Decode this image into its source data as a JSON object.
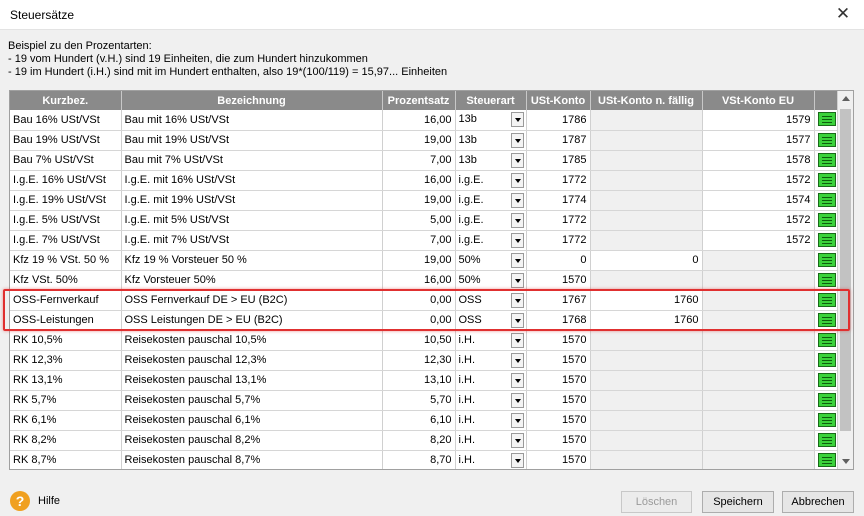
{
  "window": {
    "title": "Steuersätze"
  },
  "info": {
    "line1": "Beispiel zu den Prozentarten:",
    "line2": "- 19 vom Hundert (v.H.) sind 19 Einheiten, die zum Hundert hinzukommen",
    "line3": "- 19 im Hundert (i.H.) sind mit im Hundert enthalten, also 19*(100/119) = 15,97... Einheiten"
  },
  "table": {
    "columns": [
      "Kurzbez.",
      "Bezeichnung",
      "Prozentsatz",
      "Steuerart",
      "USt-Konto",
      "USt-Konto n. fällig",
      "VSt-Konto EU",
      ""
    ],
    "rows": [
      {
        "k": "Bau 16% USt/VSt",
        "b": "Bau mit 16% USt/VSt",
        "p": "16,00",
        "s": "13b",
        "u": "1786",
        "n": "",
        "v": "1579"
      },
      {
        "k": "Bau 19% USt/VSt",
        "b": "Bau mit 19% USt/VSt",
        "p": "19,00",
        "s": "13b",
        "u": "1787",
        "n": "",
        "v": "1577"
      },
      {
        "k": "Bau 7% USt/VSt",
        "b": "Bau mit 7% USt/VSt",
        "p": "7,00",
        "s": "13b",
        "u": "1785",
        "n": "",
        "v": "1578"
      },
      {
        "k": "I.g.E. 16% USt/VSt",
        "b": "I.g.E. mit 16% USt/VSt",
        "p": "16,00",
        "s": "i.g.E.",
        "u": "1772",
        "n": "",
        "v": "1572"
      },
      {
        "k": "I.g.E. 19% USt/VSt",
        "b": "I.g.E. mit 19% USt/VSt",
        "p": "19,00",
        "s": "i.g.E.",
        "u": "1774",
        "n": "",
        "v": "1574"
      },
      {
        "k": "I.g.E. 5% USt/VSt",
        "b": "I.g.E. mit 5% USt/VSt",
        "p": "5,00",
        "s": "i.g.E.",
        "u": "1772",
        "n": "",
        "v": "1572"
      },
      {
        "k": "I.g.E. 7% USt/VSt",
        "b": "I.g.E. mit 7% USt/VSt",
        "p": "7,00",
        "s": "i.g.E.",
        "u": "1772",
        "n": "",
        "v": "1572"
      },
      {
        "k": "Kfz 19 % VSt. 50 %",
        "b": "Kfz 19 % Vorsteuer 50 %",
        "p": "19,00",
        "s": "50%",
        "u": "0",
        "n": "0",
        "v": ""
      },
      {
        "k": "Kfz VSt. 50%",
        "b": "Kfz Vorsteuer 50%",
        "p": "16,00",
        "s": "50%",
        "u": "1570",
        "n": "",
        "v": ""
      },
      {
        "k": "OSS-Fernverkauf",
        "b": "OSS Fernverkauf DE > EU (B2C)",
        "p": "0,00",
        "s": "OSS",
        "u": "1767",
        "n": "1760",
        "v": ""
      },
      {
        "k": "OSS-Leistungen",
        "b": "OSS Leistungen DE > EU (B2C)",
        "p": "0,00",
        "s": "OSS",
        "u": "1768",
        "n": "1760",
        "v": ""
      },
      {
        "k": "RK 10,5%",
        "b": "Reisekosten pauschal 10,5%",
        "p": "10,50",
        "s": "i.H.",
        "u": "1570",
        "n": "",
        "v": ""
      },
      {
        "k": "RK 12,3%",
        "b": "Reisekosten pauschal 12,3%",
        "p": "12,30",
        "s": "i.H.",
        "u": "1570",
        "n": "",
        "v": ""
      },
      {
        "k": "RK 13,1%",
        "b": "Reisekosten pauschal 13,1%",
        "p": "13,10",
        "s": "i.H.",
        "u": "1570",
        "n": "",
        "v": ""
      },
      {
        "k": "RK 5,7%",
        "b": "Reisekosten pauschal 5,7%",
        "p": "5,70",
        "s": "i.H.",
        "u": "1570",
        "n": "",
        "v": ""
      },
      {
        "k": "RK 6,1%",
        "b": "Reisekosten pauschal 6,1%",
        "p": "6,10",
        "s": "i.H.",
        "u": "1570",
        "n": "",
        "v": ""
      },
      {
        "k": "RK 8,2%",
        "b": "Reisekosten pauschal 8,2%",
        "p": "8,20",
        "s": "i.H.",
        "u": "1570",
        "n": "",
        "v": ""
      },
      {
        "k": "RK 8,7%",
        "b": "Reisekosten pauschal 8,7%",
        "p": "8,70",
        "s": "i.H.",
        "u": "1570",
        "n": "",
        "v": ""
      }
    ]
  },
  "footer": {
    "help_label": "Hilfe",
    "delete_label": "Löschen",
    "save_label": "Speichern",
    "cancel_label": "Abbrechen"
  },
  "colors": {
    "header_bg": "#8a8a8a",
    "highlight": "#e03030",
    "edit_button": "#3bd23b"
  }
}
